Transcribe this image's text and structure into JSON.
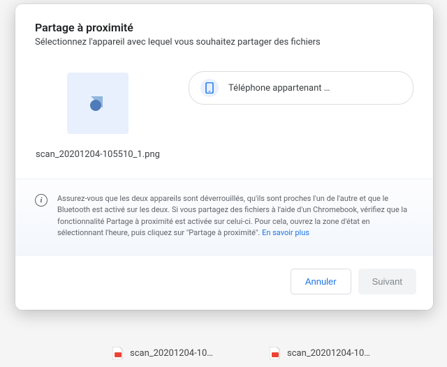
{
  "dialog": {
    "title": "Partage à proximité",
    "subtitle": "Sélectionnez l'appareil avec lequel vous souhaitez partager des fichiers"
  },
  "file": {
    "name": "scan_20201204-105510_1.png"
  },
  "device": {
    "label": "Téléphone appartenant …"
  },
  "info": {
    "text": "Assurez-vous que les deux appareils sont déverrouillés, qu'ils sont proches l'un de l'autre et que le Bluetooth est activé sur les deux. Si vous partagez des fichiers à l'aide d'un Chromebook, vérifiez que la fonctionnalité Partage à proximité est activée sur celui-ci. Pour cela, ouvrez la zone d'état en sélectionnant l'heure, puis cliquez sur \"Partage à proximité\". ",
    "link_label": "En savoir plus"
  },
  "footer": {
    "cancel_label": "Annuler",
    "next_label": "Suivant"
  },
  "background_files": {
    "item1": "scan_20201204-10…",
    "item2": "scan_20201204-10…"
  }
}
